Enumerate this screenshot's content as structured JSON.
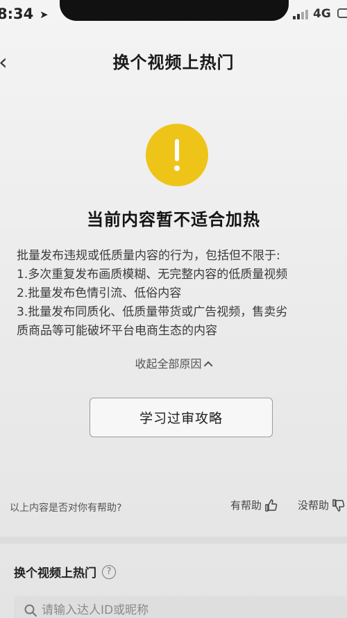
{
  "status": {
    "time": "8:34",
    "network": "4G"
  },
  "header": {
    "title": "换个视频上热门"
  },
  "notice": {
    "headline": "当前内容暂不适合加热",
    "reasons": [
      "批量发布违规或低质量内容的行为，包括但不限于:",
      "1.多次重复发布画质模糊、无完整内容的低质量视频",
      "2.批量发布色情引流、低俗内容",
      "3.批量发布同质化、低质量带货或广告视频，售卖劣",
      "质商品等可能破坏平台电商生态的内容"
    ],
    "collapse_label": "收起全部原因",
    "study_button": "学习过审攻略"
  },
  "feedback": {
    "question": "以上内容是否对你有帮助?",
    "helpful": "有帮助",
    "not_helpful": "没帮助"
  },
  "section": {
    "title": "换个视频上热门",
    "search_placeholder": "请输入达人ID或昵称"
  },
  "colors": {
    "warning": "#efc419"
  }
}
